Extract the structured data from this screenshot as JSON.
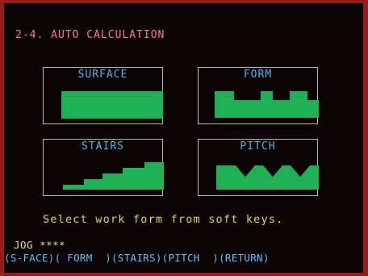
{
  "screen": {
    "title": "2-4. AUTO CALCULATION"
  },
  "panels": {
    "surface": {
      "label": "SURFACE"
    },
    "form": {
      "label": "FORM"
    },
    "stairs": {
      "label": "STAIRS"
    },
    "pitch": {
      "label": "PITCH"
    }
  },
  "message": "Select work form from soft keys.",
  "status": {
    "mode": "JOG  ****"
  },
  "softkeys": [
    {
      "label": "(S-FACE)"
    },
    {
      "label": "( FORM  )"
    },
    {
      "label": "(STAIRS)"
    },
    {
      "label": "(PITCH  )"
    },
    {
      "label": "(RETURN)"
    }
  ],
  "colors": {
    "background": "#0a0303",
    "frame": "#9b1a1a",
    "title": "#ff7b91",
    "panel_border": "#c9c254",
    "panel_label": "#4fb4e6",
    "shape_fill": "#1fb055",
    "message": "#e8d64a",
    "softkey": "#5ec2ff"
  },
  "icons": {
    "surface": "flat-surface-icon",
    "form": "stepped-form-icon",
    "stairs": "stairs-profile-icon",
    "pitch": "pitch-teeth-icon"
  }
}
